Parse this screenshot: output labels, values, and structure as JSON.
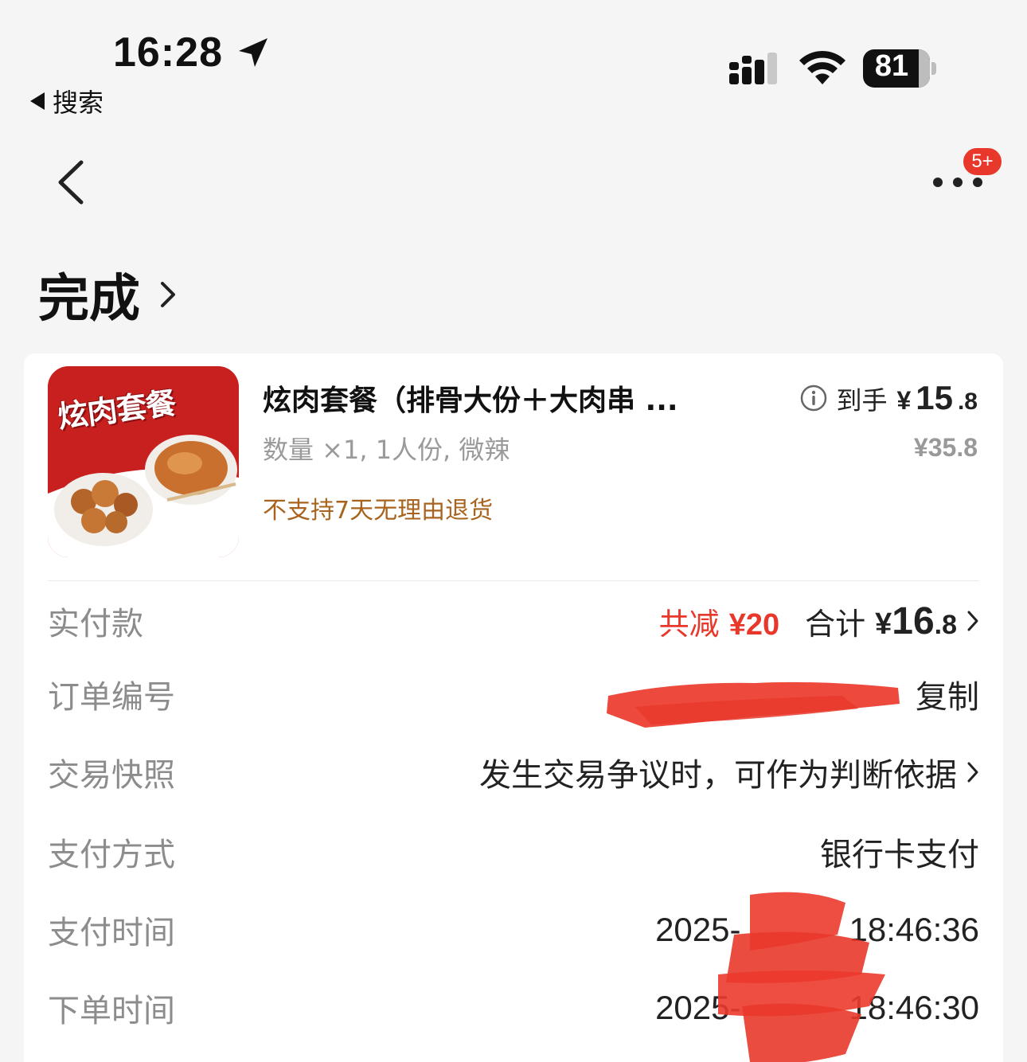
{
  "status_bar": {
    "time": "16:28",
    "back_label": "搜索",
    "battery": "81",
    "icons": [
      "location-arrow-icon",
      "signal-icon",
      "wifi-icon",
      "battery-icon"
    ]
  },
  "nav": {
    "badge": "5+",
    "icons": [
      "chevron-left-icon",
      "more-dots-icon"
    ]
  },
  "status": {
    "title": "完成"
  },
  "product": {
    "image_title": "炫肉套餐",
    "name": "炫肉套餐（排骨大份＋大肉串 ...",
    "spec": "数量 ×1, 1人份, 微辣",
    "policy": "不支持7天无理由退货",
    "net_label": "到手",
    "net_currency": "¥",
    "net_int": "15",
    "net_dec": ".8",
    "original_price": "¥35.8"
  },
  "details": {
    "paid": {
      "label": "实付款",
      "discount_prefix": "共减",
      "discount_amount": "¥20",
      "total_label": "合计",
      "total_currency": "¥",
      "total_int": "16",
      "total_dec": ".8"
    },
    "order_no": {
      "label": "订单编号",
      "action": "复制"
    },
    "snapshot": {
      "label": "交易快照",
      "value": "发生交易争议时，可作为判断依据"
    },
    "pay_method": {
      "label": "支付方式",
      "value": "银行卡支付"
    },
    "pay_time": {
      "label": "支付时间",
      "date_prefix": "2025-",
      "time": "18:46:36"
    },
    "order_time": {
      "label": "下单时间",
      "date_prefix": "2025-",
      "time": "18:46:30"
    }
  },
  "colors": {
    "accent_red": "#e8382b",
    "policy_brown": "#a8641e",
    "label_gray": "#8c8c8c",
    "background": "#f5f5f5"
  }
}
